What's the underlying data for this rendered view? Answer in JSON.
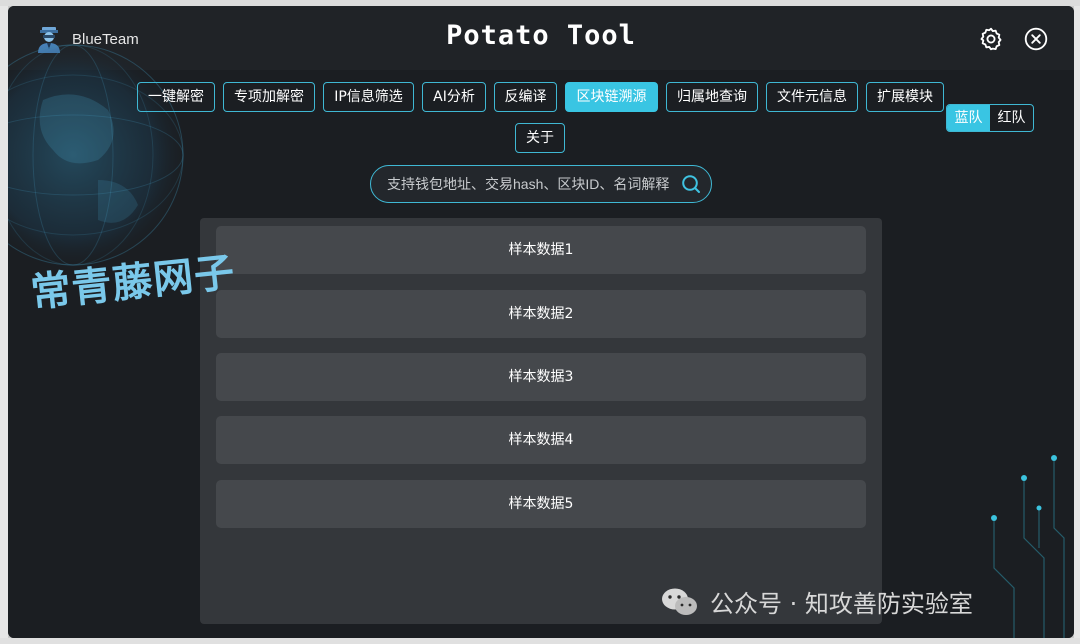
{
  "window": {
    "brand_name": "BlueTeam",
    "app_title": "Potato Tool"
  },
  "tabs": [
    {
      "label": "一键解密",
      "active": false
    },
    {
      "label": "专项加解密",
      "active": false
    },
    {
      "label": "IP信息筛选",
      "active": false
    },
    {
      "label": "AI分析",
      "active": false
    },
    {
      "label": "反编译",
      "active": false
    },
    {
      "label": "区块链溯源",
      "active": true
    },
    {
      "label": "归属地查询",
      "active": false
    },
    {
      "label": "文件元信息",
      "active": false
    },
    {
      "label": "扩展模块",
      "active": false
    },
    {
      "label": "关于",
      "active": false
    }
  ],
  "team_toggle": {
    "blue_label": "蓝队",
    "red_label": "红队",
    "selected": "蓝队"
  },
  "search": {
    "placeholder": "支持钱包地址、交易hash、区块ID、名词解释"
  },
  "results": [
    "样本数据1",
    "样本数据2",
    "样本数据3",
    "样本数据4",
    "样本数据5"
  ],
  "watermarks": {
    "left": "常青藤网子",
    "right": "公众号 · 知攻善防实验室"
  },
  "colors": {
    "accent": "#39c5e3",
    "background": "#1b1e22",
    "panel": "#34373b",
    "row": "#45484c"
  },
  "icons": {
    "brand": "agent-avatar-icon",
    "settings": "gear-icon",
    "close": "close-icon",
    "search": "search-icon",
    "wechat": "wechat-icon"
  }
}
